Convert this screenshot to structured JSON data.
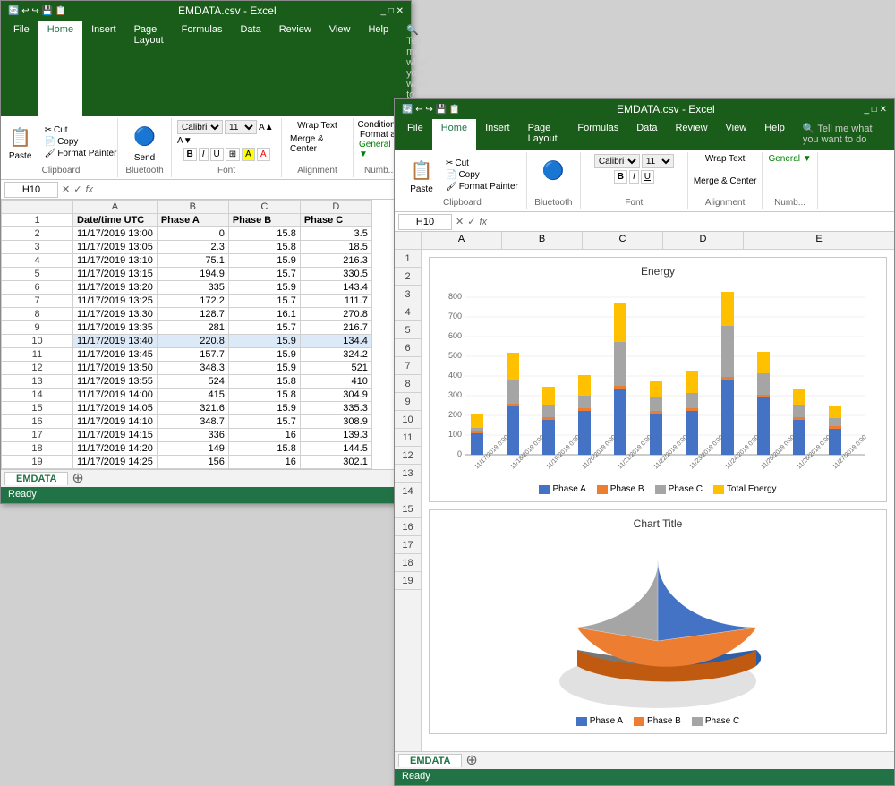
{
  "app": {
    "title": "EMDATA.csv - Excel"
  },
  "window_back": {
    "title": "EMDATA.csv - Excel",
    "tabs": [
      "File",
      "Home",
      "Insert",
      "Page Layout",
      "Formulas",
      "Data",
      "Review",
      "View",
      "Help"
    ],
    "active_tab": "Home",
    "tell_me": "Tell me what you want to do",
    "ribbon": {
      "clipboard_group": "Clipboard",
      "font_group": "Font",
      "alignment_group": "Alignment",
      "paste_label": "Paste",
      "cut_label": "Cut",
      "copy_label": "Copy",
      "format_painter_label": "Format Painter",
      "wrap_text_label": "Wrap Text",
      "merge_label": "Merge & Center",
      "bluetooth_label": "Bluetooth",
      "send_label": "Send",
      "font_name": "Calibri",
      "font_size": "11",
      "conditional_label": "Conditional",
      "format_as_label": "Format as"
    },
    "formula_bar": {
      "cell_ref": "H10",
      "formula": ""
    },
    "columns": [
      "A",
      "B",
      "C",
      "D"
    ],
    "col_widths": [
      "180px",
      "80px",
      "80px",
      "80px"
    ],
    "headers": [
      "Date/time UTC",
      "Phase A",
      "Phase B",
      "Phase C"
    ],
    "rows": [
      {
        "num": 1,
        "a": "Date/time UTC",
        "b": "Phase A",
        "c": "Phase B",
        "d": "Phase C"
      },
      {
        "num": 2,
        "a": "11/17/2019 13:00",
        "b": "0",
        "c": "15.8",
        "d": "3.5"
      },
      {
        "num": 3,
        "a": "11/17/2019 13:05",
        "b": "2.3",
        "c": "15.8",
        "d": "18.5"
      },
      {
        "num": 4,
        "a": "11/17/2019 13:10",
        "b": "75.1",
        "c": "15.9",
        "d": "216.3"
      },
      {
        "num": 5,
        "a": "11/17/2019 13:15",
        "b": "194.9",
        "c": "15.7",
        "d": "330.5"
      },
      {
        "num": 6,
        "a": "11/17/2019 13:20",
        "b": "335",
        "c": "15.9",
        "d": "143.4"
      },
      {
        "num": 7,
        "a": "11/17/2019 13:25",
        "b": "172.2",
        "c": "15.7",
        "d": "111.7"
      },
      {
        "num": 8,
        "a": "11/17/2019 13:30",
        "b": "128.7",
        "c": "16.1",
        "d": "270.8"
      },
      {
        "num": 9,
        "a": "11/17/2019 13:35",
        "b": "281",
        "c": "15.7",
        "d": "216.7"
      },
      {
        "num": 10,
        "a": "11/17/2019 13:40",
        "b": "220.8",
        "c": "15.9",
        "d": "134.4"
      },
      {
        "num": 11,
        "a": "11/17/2019 13:45",
        "b": "157.7",
        "c": "15.9",
        "d": "324.2"
      },
      {
        "num": 12,
        "a": "11/17/2019 13:50",
        "b": "348.3",
        "c": "15.9",
        "d": "521"
      },
      {
        "num": 13,
        "a": "11/17/2019 13:55",
        "b": "524",
        "c": "15.8",
        "d": "410"
      },
      {
        "num": 14,
        "a": "11/17/2019 14:00",
        "b": "415",
        "c": "15.8",
        "d": "304.9"
      },
      {
        "num": 15,
        "a": "11/17/2019 14:05",
        "b": "321.6",
        "c": "15.9",
        "d": "335.3"
      },
      {
        "num": 16,
        "a": "11/17/2019 14:10",
        "b": "348.7",
        "c": "15.7",
        "d": "308.9"
      },
      {
        "num": 17,
        "a": "11/17/2019 14:15",
        "b": "336",
        "c": "16",
        "d": "139.3"
      },
      {
        "num": 18,
        "a": "11/17/2019 14:20",
        "b": "149",
        "c": "15.8",
        "d": "144.5"
      },
      {
        "num": 19,
        "a": "11/17/2019 14:25",
        "b": "156",
        "c": "16",
        "d": "302.1"
      }
    ],
    "sheet_tab": "EMDATA",
    "status": "Ready"
  },
  "window_front": {
    "title": "EMDATA.csv - Excel",
    "tabs": [
      "File",
      "Home",
      "Insert",
      "Page Layout",
      "Formulas",
      "Data",
      "Review",
      "View",
      "Help"
    ],
    "active_tab": "Home",
    "tell_me": "Tell me what you want to do",
    "ribbon": {
      "clipboard_group": "Clipboard",
      "font_group": "Font",
      "alignment_group": "Alignment",
      "paste_label": "Paste",
      "cut_label": "Cut",
      "copy_label": "Copy",
      "format_painter_label": "Format Painter",
      "wrap_text_label": "Wrap Text",
      "merge_label": "Merge & Center",
      "bluetooth_label": "Bluetooth",
      "send_label": "Send",
      "font_name": "Calibri",
      "font_size": "11"
    },
    "formula_bar": {
      "cell_ref": "H10",
      "formula": ""
    },
    "columns": [
      "A",
      "B",
      "C",
      "D",
      "E"
    ],
    "rows_visible": [
      1,
      2,
      3,
      4,
      5,
      6,
      7,
      8,
      9,
      10,
      11,
      12,
      13,
      14,
      15,
      16,
      17,
      18,
      19
    ],
    "chart1": {
      "title": "Energy",
      "y_labels": [
        "800",
        "700",
        "600",
        "500",
        "400",
        "300",
        "200",
        "100",
        "0"
      ],
      "x_labels": [
        "11/17/2019 0:00",
        "11/18/2019 0:00",
        "11/19/2019 0:00",
        "11/20/2019 0:00",
        "11/21/2019 0:00",
        "11/22/2019 0:00",
        "11/23/2019 0:00",
        "11/24/2019 0:00",
        "11/25/2019 0:00",
        "11/26/2019 0:00",
        "11/27/2019 0:00"
      ],
      "legend": [
        "Phase A",
        "Phase B",
        "Phase C",
        "Total Energy"
      ],
      "legend_colors": [
        "#4472C4",
        "#ED7D31",
        "#A5A5A5",
        "#FFC000"
      ]
    },
    "chart2": {
      "title": "Chart Title",
      "legend": [
        "Phase A",
        "Phase B",
        "Phase C"
      ],
      "legend_colors": [
        "#4472C4",
        "#ED7D31",
        "#A5A5A5"
      ],
      "slices": [
        {
          "label": "Phase A",
          "color": "#4472C4",
          "percent": 33
        },
        {
          "label": "Phase B",
          "color": "#ED7D31",
          "percent": 33
        },
        {
          "label": "Phase C",
          "color": "#A5A5A5",
          "percent": 34
        }
      ]
    },
    "sheet_tab": "EMDATA",
    "status": "Ready"
  },
  "colors": {
    "excel_green": "#217346",
    "excel_dark_green": "#1a5c1a",
    "ribbon_border": "#c8c8c8",
    "selected_cell": "#dce9f7"
  }
}
